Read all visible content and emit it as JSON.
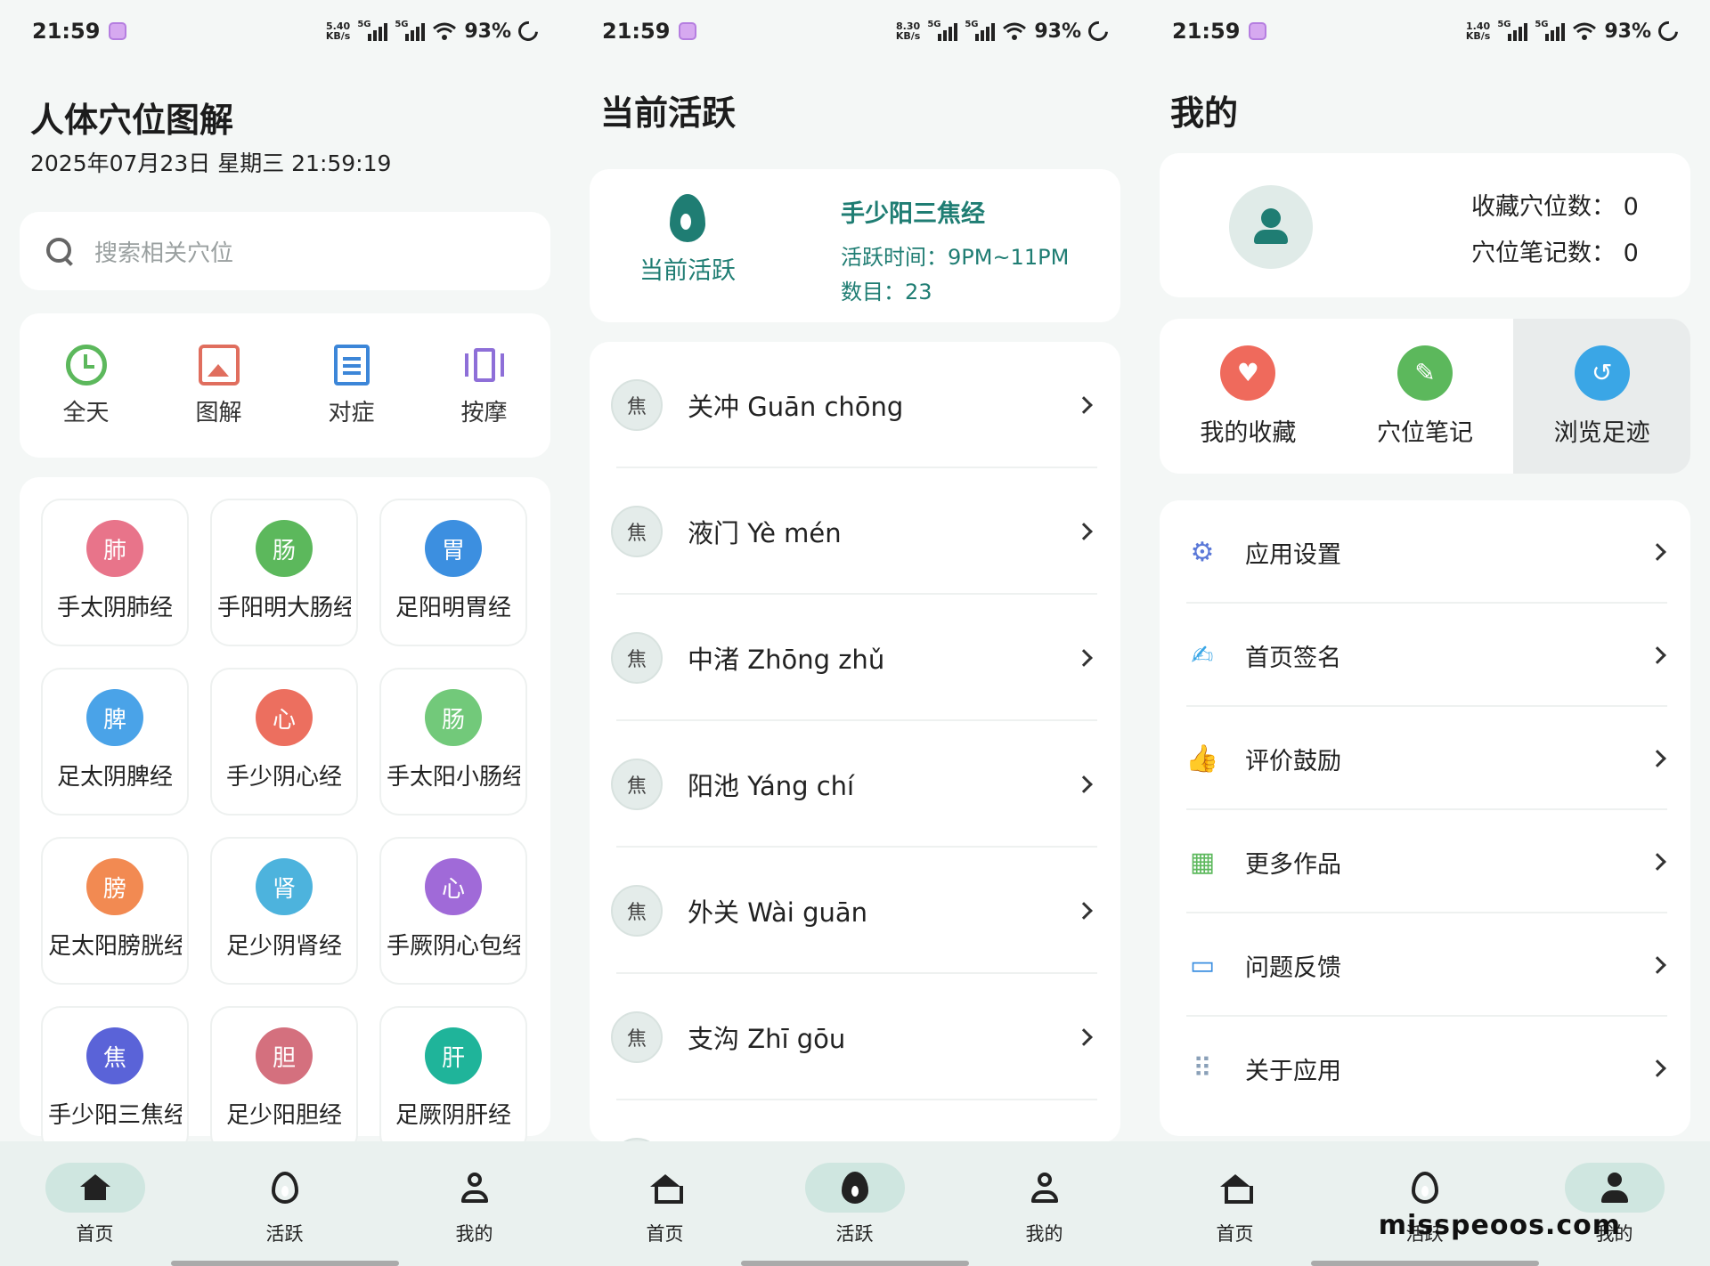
{
  "status": [
    {
      "time": "21:59",
      "speed": "5.40\nKB/s",
      "battery": "93%"
    },
    {
      "time": "21:59",
      "speed": "8.30\nKB/s",
      "battery": "93%"
    },
    {
      "time": "21:59",
      "speed": "1.40\nKB/s",
      "battery": "93%"
    }
  ],
  "home": {
    "title": "人体穴位图解",
    "date": "2025年07月23日 星期三  21:59:19",
    "search_placeholder": "搜索相关穴位",
    "quick": [
      {
        "label": "全天",
        "icon": "clock-icon"
      },
      {
        "label": "图解",
        "icon": "image-icon"
      },
      {
        "label": "对症",
        "icon": "document-icon"
      },
      {
        "label": "按摩",
        "icon": "massage-icon"
      }
    ],
    "meridians": [
      {
        "char": "肺",
        "name": "手太阴肺经",
        "color": "#e8748a"
      },
      {
        "char": "肠",
        "name": "手阳明大肠经",
        "color": "#5cb85c"
      },
      {
        "char": "胃",
        "name": "足阳明胃经",
        "color": "#3c8fe0"
      },
      {
        "char": "脾",
        "name": "足太阴脾经",
        "color": "#4aa3e8"
      },
      {
        "char": "心",
        "name": "手少阴心经",
        "color": "#ec6f5f"
      },
      {
        "char": "肠",
        "name": "手太阳小肠经",
        "color": "#72c97a"
      },
      {
        "char": "膀",
        "name": "足太阳膀胱经",
        "color": "#f28a52"
      },
      {
        "char": "肾",
        "name": "足少阴肾经",
        "color": "#4db3dd"
      },
      {
        "char": "心",
        "name": "手厥阴心包经",
        "color": "#a06ad8"
      },
      {
        "char": "焦",
        "name": "手少阳三焦经",
        "color": "#5a63d8"
      },
      {
        "char": "胆",
        "name": "足少阳胆经",
        "color": "#d4707e"
      },
      {
        "char": "肝",
        "name": "足厥阴肝经",
        "color": "#1fb49a"
      }
    ]
  },
  "active": {
    "title": "当前活跃",
    "card_label": "当前活跃",
    "meridian": "手少阳三焦经",
    "time": "活跃时间：9PM~11PM",
    "count": "数目：23",
    "acupoints": [
      {
        "badge": "焦",
        "name": "关冲 Guān chōng"
      },
      {
        "badge": "焦",
        "name": "液门 Yè mén"
      },
      {
        "badge": "焦",
        "name": "中渚 Zhōng zhǔ"
      },
      {
        "badge": "焦",
        "name": "阳池 Yáng chí"
      },
      {
        "badge": "焦",
        "name": "外关 Wài guān"
      },
      {
        "badge": "焦",
        "name": "支沟 Zhī gōu"
      }
    ]
  },
  "mine": {
    "title": "我的",
    "fav_count": "收藏穴位数：  0",
    "note_count": "穴位笔记数：  0",
    "shortcuts": [
      {
        "label": "我的收藏",
        "icon": "heart-icon",
        "color": "#ef6a5c"
      },
      {
        "label": "穴位笔记",
        "icon": "note-icon",
        "color": "#5cb85c"
      },
      {
        "label": "浏览足迹",
        "icon": "history-icon",
        "color": "#3aa6e6"
      }
    ],
    "menu": [
      {
        "label": "应用设置",
        "icon": "gear-icon",
        "color": "#5a78d8"
      },
      {
        "label": "首页签名",
        "icon": "signature-icon",
        "color": "#3aa6e6"
      },
      {
        "label": "评价鼓励",
        "icon": "thumbs-up-icon",
        "color": "#ef6a5c"
      },
      {
        "label": "更多作品",
        "icon": "apps-icon",
        "color": "#5cb85c"
      },
      {
        "label": "问题反馈",
        "icon": "feedback-icon",
        "color": "#3c8fe0"
      },
      {
        "label": "关于应用",
        "icon": "grid-dots-icon",
        "color": "#8aa0b8"
      }
    ]
  },
  "nav": {
    "home": "首页",
    "active": "活跃",
    "mine": "我的"
  },
  "watermark": "misspeoos.com"
}
